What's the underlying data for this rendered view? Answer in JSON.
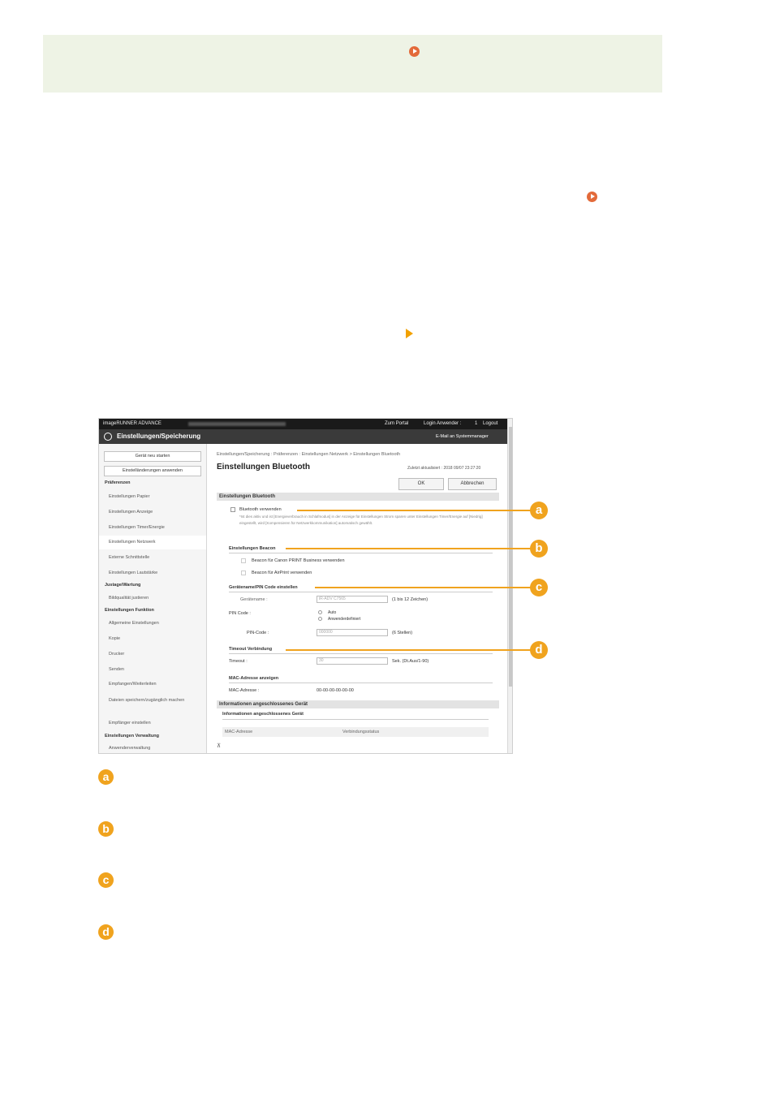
{
  "screen": {
    "top_brand": "imageRUNNER ADVANCE",
    "top_links": {
      "portal": "Zum Portal",
      "login_user": "Login Anwender :",
      "login_num": "1",
      "logout": "Logout"
    },
    "title": "Einstellungen/Speicherung",
    "email_admin": "E-Mail an Systemmanager",
    "sidebar": {
      "btn_restart": "Gerät neu starten",
      "btn_apply": "Einstelländerungen anwenden",
      "head_prefs": "Präferenzen",
      "items_prefs": [
        "Einstellungen Papier",
        "Einstellungen Anzeige",
        "Einstellungen Timer/Energie",
        "Einstellungen Netzwerk",
        "Externe Schnittstelle",
        "Einstellungen Lautstärke"
      ],
      "head_adjust": "Justage/Wartung",
      "items_adjust": [
        "Bildqualität justieren"
      ],
      "head_functions": "Einstellungen Funktion",
      "items_functions": [
        "Allgemeine Einstellungen",
        "Kopie",
        "Drucker",
        "Senden",
        "Empfangen/Weiterleiten",
        "Dateien speichern/zugänglich machen"
      ],
      "items_recv": [
        "Empfänger einstellen"
      ],
      "head_mgmt": "Einstellungen Verwaltung",
      "items_mgmt": [
        "Anwenderverwaltung"
      ]
    },
    "breadcrumb": "Einstellungen/Speicherung : Präferenzen : Einstellungen Netzwerk > Einstellungen Bluetooth",
    "page_title": "Einstellungen Bluetooth",
    "last_updated": "Zuletzt aktualisiert : 2018 09/07 23:27:20",
    "btn_ok": "OK",
    "btn_cancel": "Abbrechen",
    "sec_bluetooth": "Einstellungen Bluetooth",
    "use_bluetooth": "Bluetooth verwenden",
    "bt_note": "*Ist dies aktiv und ist [Energieverbrauch in Schlafmodus] in der Anzeige für Einstellungen Strom sparen unter Einstellungen Timer/Energie auf [Niedrig] eingestellt, wird [Kompensieren für Netzwerkkommunikation] automatisch gewählt.",
    "sec_beacon": "Einstellungen Beacon",
    "beacon_1": "Beacon für Canon PRINT Business verwenden",
    "beacon_2": "Beacon für AirPrint verwenden",
    "sec_devname": "Gerätename/PIN Code einstellen",
    "devname_label": "Gerätename :",
    "devname_value": "iR-ADV C7565",
    "devname_hint": "(1 bis 12 Zeichen)",
    "pin_label": "PIN Code :",
    "pin_auto": "Auto",
    "pin_user": "Anwenderdefiniert",
    "pincode_label": "PIN-Code :",
    "pincode_value": "000000",
    "pincode_hint": "(6 Stellen)",
    "sec_timeout": "Timeout Verbindung",
    "timeout_label": "Timeout :",
    "timeout_value": "30",
    "timeout_hint": "Sek. (Dt.Aus/1-90)",
    "sec_mac": "MAC-Adresse anzeigen",
    "mac_label": "MAC-Adresse :",
    "mac_value": "00-00-00-00-00-00",
    "sec_info": "Informationen angeschlossenes Gerät",
    "info_sub": "Informationen angeschlossenes Gerät",
    "info_cols": [
      "MAC-Adresse",
      "Verbindungsstatus"
    ]
  },
  "callouts": [
    "a",
    "b",
    "c",
    "d"
  ]
}
